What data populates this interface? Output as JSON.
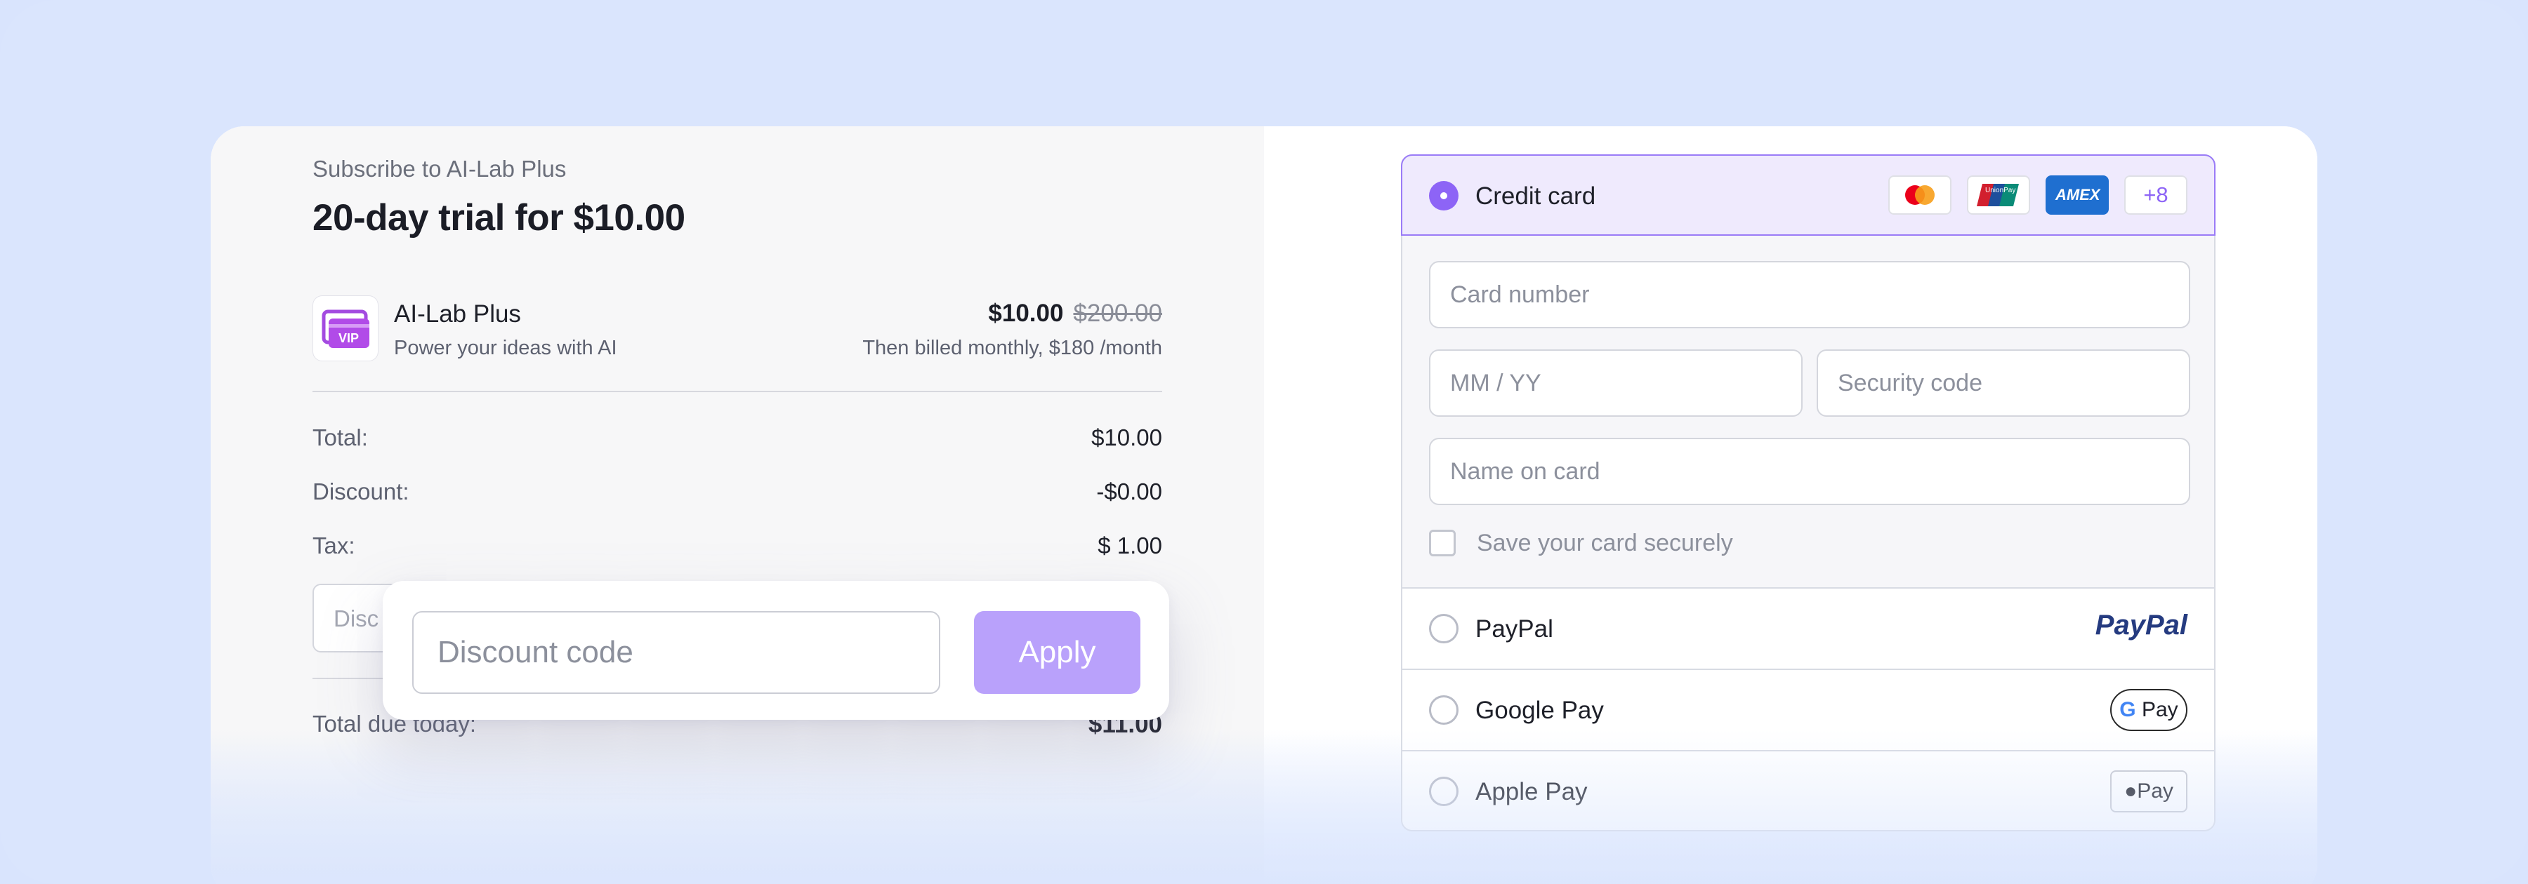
{
  "summary": {
    "subtitle": "Subscribe to AI-Lab Plus",
    "headline": "20-day trial for $10.00",
    "product": {
      "name": "AI-Lab Plus",
      "tagline": "Power your ideas with AI",
      "icon_label": "VIP",
      "price": "$10.00",
      "original_price": "$200.00",
      "billing_note": "Then billed monthly, $180 /month"
    },
    "lines": [
      {
        "label": "Total:",
        "value": "$10.00"
      },
      {
        "label": "Discount:",
        "value": "-$0.00"
      },
      {
        "label": "Tax:",
        "value": "$ 1.00"
      }
    ],
    "discount_background_placeholder": "Disc",
    "total_due_label": "Total due today:",
    "total_due_value": "$11.00"
  },
  "discount_popup": {
    "placeholder": "Discount code",
    "apply_label": "Apply",
    "apply_color": "#b9a1fb"
  },
  "payment": {
    "credit_card": {
      "label": "Credit card",
      "selected": true,
      "card_logos": [
        "mastercard-icon",
        "unionpay-icon",
        "amex-icon"
      ],
      "amex_text": "AMEX",
      "unionpay_text": "UnionPay",
      "more_label": "+8",
      "card_number_placeholder": "Card number",
      "expiry_placeholder": "MM / YY",
      "security_placeholder": "Security code",
      "name_placeholder": "Name on card",
      "save_label": "Save your card securely"
    },
    "methods": [
      {
        "label": "PayPal",
        "logo": "PayPal"
      },
      {
        "label": "Google Pay",
        "logo": "Pay"
      },
      {
        "label": "Apple Pay",
        "logo": "Pay"
      }
    ],
    "accent_color": "#8d64f6"
  }
}
